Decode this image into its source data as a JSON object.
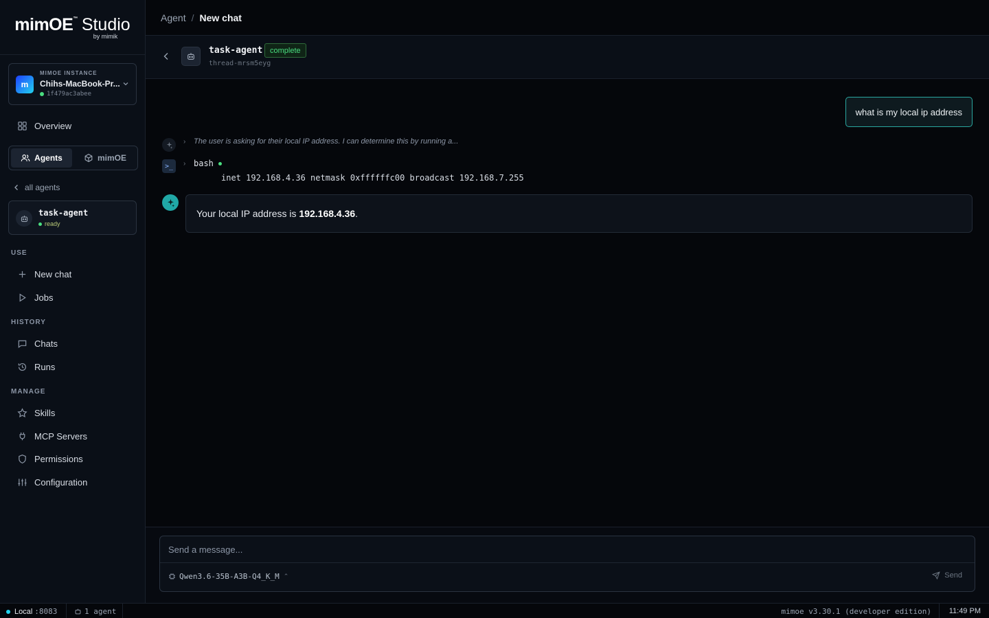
{
  "app": {
    "brand": "mimOE",
    "tm": "™",
    "product": "Studio",
    "byline": "by mimik"
  },
  "instance": {
    "kicker": "MIMOE INSTANCE",
    "avatar_letter": "m",
    "name": "Chihs-MacBook-Pr...",
    "id": "1f479ac3abee"
  },
  "nav": {
    "overview": "Overview",
    "seg_agents": "Agents",
    "seg_mimoe": "mimOE",
    "all_agents": "all agents",
    "agent_card": {
      "name": "task-agent",
      "status": "ready"
    },
    "sections": {
      "use": "USE",
      "history": "HISTORY",
      "manage": "MANAGE"
    },
    "use_items": [
      "New chat",
      "Jobs"
    ],
    "history_items": [
      "Chats",
      "Runs"
    ],
    "manage_items": [
      "Skills",
      "MCP Servers",
      "Permissions",
      "Configuration"
    ]
  },
  "breadcrumb": {
    "parent": "Agent",
    "sep": "/",
    "current": "New chat"
  },
  "agent_header": {
    "name": "task-agent",
    "badge": "complete",
    "thread": "thread-mrsm5eyg"
  },
  "chat": {
    "user_message": "what is my local ip address",
    "thinking": "The user is asking for their local IP address. I can determine this by running a...",
    "tool_name": "bash",
    "tool_output": "inet 192.168.4.36 netmask 0xffffffc00 broadcast 192.168.7.255",
    "reply_prefix": "Your local IP address is ",
    "reply_value": "192.168.4.36",
    "reply_suffix": "."
  },
  "composer": {
    "placeholder": "Send a message...",
    "model": "Qwen3.6-35B-A3B-Q4_K_M",
    "send_label": "Send"
  },
  "statusbar": {
    "local_label": "Local",
    "port": ":8083",
    "agents": "1 agent",
    "version": "mimoe v3.30.1 (developer edition)",
    "time": "11:49 PM"
  },
  "colors": {
    "accent_teal": "#2aa7a0",
    "status_green": "#4ade80",
    "badge_green": "#4ade80"
  }
}
